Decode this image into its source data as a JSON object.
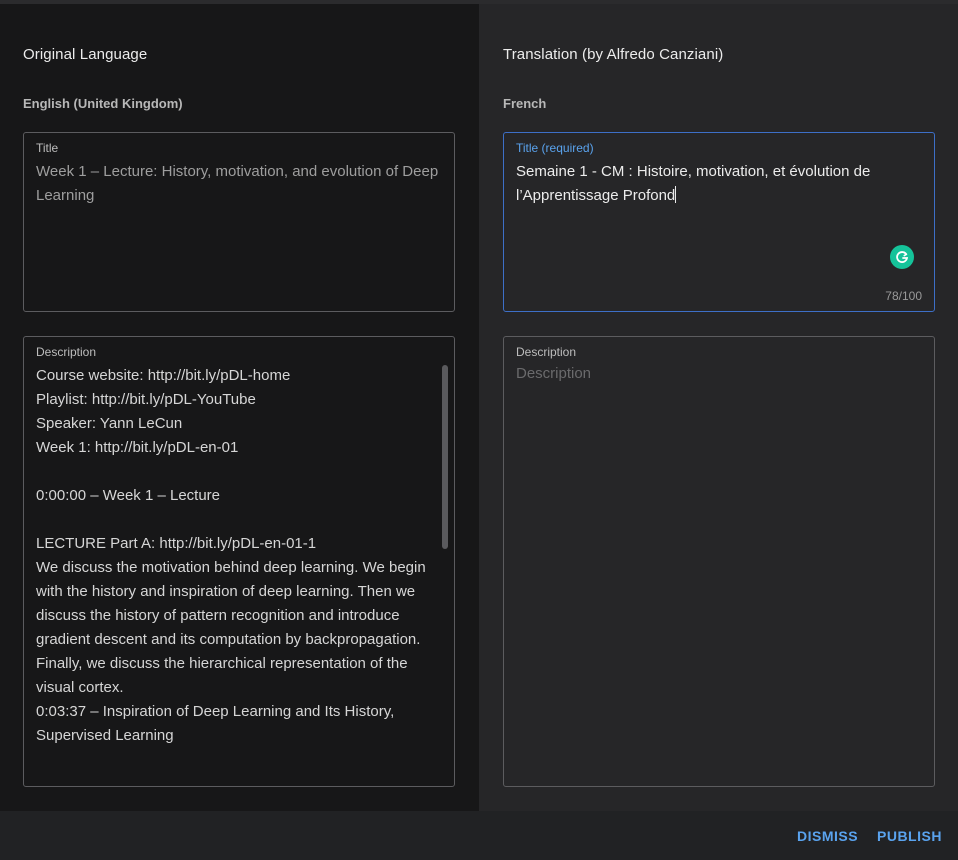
{
  "original": {
    "heading": "Original Language",
    "language": "English (United Kingdom)",
    "title_label": "Title",
    "title_value": "Week 1 – Lecture: History, motivation, and evolution of Deep\nLearning",
    "description_label": "Description",
    "description_lines": [
      "Course website: http://bit.ly/pDL-home",
      "Playlist: http://bit.ly/pDL-YouTube",
      "Speaker: Yann LeCun",
      "Week 1: http://bit.ly/pDL-en-01",
      "",
      "0:00:00 – Week 1 – Lecture",
      "",
      "LECTURE Part A: http://bit.ly/pDL-en-01-1",
      "We discuss the motivation behind deep learning. We begin",
      "with the history and inspiration of deep learning. Then we",
      "discuss the history of pattern recognition and introduce",
      "gradient descent and its computation by backpropagation.",
      "Finally, we discuss the hierarchical representation of the",
      "visual cortex.",
      "0:03:37 – Inspiration of Deep Learning and Its History,",
      "Supervised Learning"
    ]
  },
  "translation": {
    "heading": "Translation (by Alfredo Canziani)",
    "language": "French",
    "title_label": "Title (required)",
    "title_value": "Semaine 1 - CM : Histoire, motivation, et évolution de\nl’Apprentissage Profond",
    "title_counter": "78/100",
    "description_label": "Description",
    "description_placeholder": "Description"
  },
  "footer": {
    "dismiss_label": "DISMISS",
    "publish_label": "PUBLISH"
  },
  "colors": {
    "accent": "#5aa3ee",
    "grammarly": "#15c39a",
    "focus_border": "#3d6fc7"
  },
  "icons": {
    "grammarly": "grammarly-icon"
  }
}
